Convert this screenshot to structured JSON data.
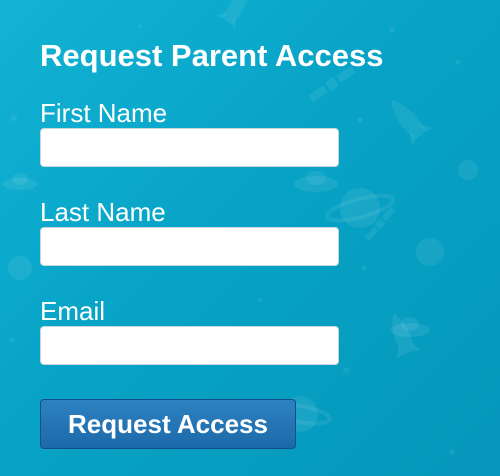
{
  "form": {
    "title": "Request Parent Access",
    "fields": [
      {
        "label": "First Name",
        "value": "",
        "placeholder": ""
      },
      {
        "label": "Last Name",
        "value": "",
        "placeholder": ""
      },
      {
        "label": "Email",
        "value": "",
        "placeholder": ""
      }
    ],
    "submit_label": "Request Access"
  },
  "colors": {
    "background": "#0aa6c9",
    "button": "#2473b5",
    "text": "#ffffff"
  },
  "background_icons": [
    "rocket-icon",
    "planet-icon",
    "satellite-icon",
    "ufo-icon",
    "star-icon"
  ]
}
